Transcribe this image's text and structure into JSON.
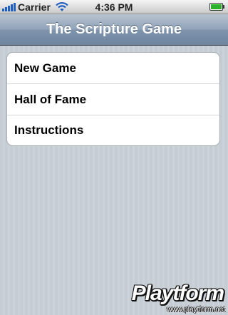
{
  "status_bar": {
    "carrier": "Carrier",
    "time": "4:36 PM",
    "icons": [
      "signal-bars-icon",
      "wifi-icon",
      "battery-icon"
    ],
    "battery_level": 1.0
  },
  "nav": {
    "title": "The Scripture Game"
  },
  "menu": {
    "items": [
      {
        "label": "New Game"
      },
      {
        "label": "Hall of Fame"
      },
      {
        "label": "Instructions"
      }
    ]
  },
  "watermark": {
    "logo": "Playtform",
    "url": "www.playtform.net"
  },
  "colors": {
    "nav_bar": "#8fa2b8",
    "background": "#c5ccd4",
    "menu_background": "#ffffff",
    "signal": "#1f5fc2",
    "battery": "#2ab32a"
  }
}
